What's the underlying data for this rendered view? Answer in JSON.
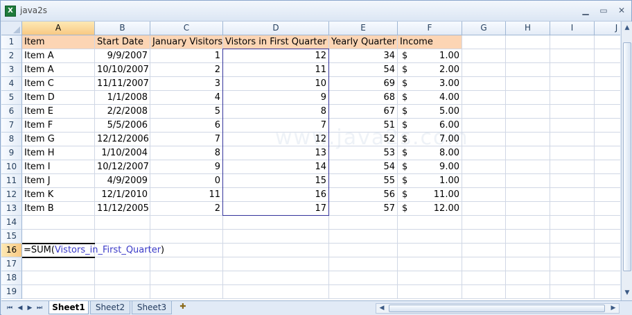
{
  "window": {
    "title": "java2s",
    "icon": "excel-icon"
  },
  "columns": [
    "A",
    "B",
    "C",
    "D",
    "E",
    "F",
    "G",
    "H",
    "I",
    "J"
  ],
  "rows": [
    "1",
    "2",
    "3",
    "4",
    "5",
    "6",
    "7",
    "8",
    "9",
    "10",
    "11",
    "12",
    "13",
    "14",
    "15",
    "16",
    "17",
    "18",
    "19"
  ],
  "table": {
    "headers": [
      "Item",
      "Start Date",
      "January Visitors",
      "Vistors in First Quarter",
      "Yearly Quarter",
      "Income"
    ],
    "data": [
      [
        "Item A",
        "9/9/2007",
        "1",
        "12",
        "34",
        "$",
        "1.00"
      ],
      [
        "Item A",
        "10/10/2007",
        "2",
        "11",
        "54",
        "$",
        "2.00"
      ],
      [
        "Item C",
        "11/11/2007",
        "3",
        "10",
        "69",
        "$",
        "3.00"
      ],
      [
        "Item D",
        "1/1/2008",
        "4",
        "9",
        "68",
        "$",
        "4.00"
      ],
      [
        "Item E",
        "2/2/2008",
        "5",
        "8",
        "67",
        "$",
        "5.00"
      ],
      [
        "Item F",
        "5/5/2006",
        "6",
        "7",
        "51",
        "$",
        "6.00"
      ],
      [
        "Item G",
        "12/12/2006",
        "7",
        "12",
        "52",
        "$",
        "7.00"
      ],
      [
        "Item H",
        "1/10/2004",
        "8",
        "13",
        "53",
        "$",
        "8.00"
      ],
      [
        "Item I",
        "10/12/2007",
        "9",
        "14",
        "54",
        "$",
        "9.00"
      ],
      [
        "Item J",
        "4/9/2009",
        "0",
        "15",
        "55",
        "$",
        "1.00"
      ],
      [
        "Item K",
        "12/1/2010",
        "11",
        "16",
        "56",
        "$",
        "11.00"
      ],
      [
        "Item B",
        "11/12/2005",
        "2",
        "17",
        "57",
        "$",
        "12.00"
      ]
    ]
  },
  "formula": {
    "prefix": "=SUM(",
    "ref": "Vistors_in_First_Quarter",
    "suffix": ")"
  },
  "active_cell": {
    "column": "A",
    "row": "16"
  },
  "watermark": "www.java2s.com",
  "sheet_tabs": [
    "Sheet1",
    "Sheet2",
    "Sheet3"
  ],
  "active_sheet": "Sheet1",
  "colors": {
    "header_fill": "#fcd5b4",
    "range_border": "#34349c",
    "selected_header": "#f8c983"
  }
}
